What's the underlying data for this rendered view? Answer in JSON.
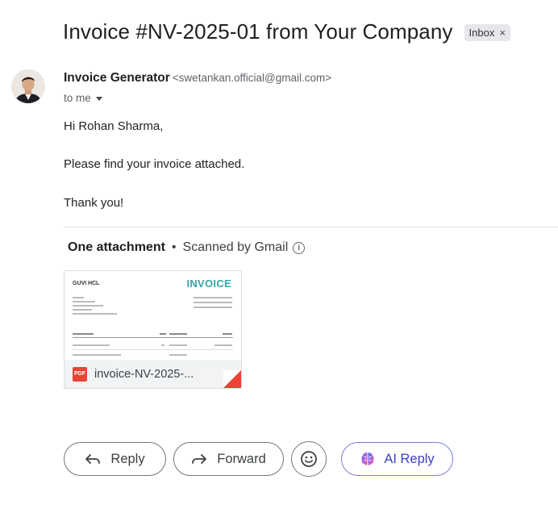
{
  "email": {
    "subject": "Invoice #NV-2025-01 from Your Company",
    "label": "Inbox",
    "label_remove": "×",
    "sender_name": "Invoice Generator",
    "sender_email": "<swetankan.official@gmail.com>",
    "recipient": "to me",
    "body": {
      "greeting": "Hi Rohan Sharma,",
      "message": "Please find your invoice attached.",
      "closing": "Thank you!"
    }
  },
  "attachments": {
    "count_label": "One attachment",
    "separator": "•",
    "scan_label": "Scanned by Gmail",
    "items": [
      {
        "file_name": "invoice-NV-2025-...",
        "file_type": "PDF",
        "thumbnail_company": "GUVI HCL",
        "thumbnail_title": "INVOICE",
        "accent_color": "#35a6a6"
      }
    ]
  },
  "actions": {
    "reply": "Reply",
    "forward": "Forward",
    "emoji": "emoji-icon",
    "ai_reply": "AI Reply"
  },
  "colors": {
    "pdf_red": "#ea4335",
    "ai_accent": "#3b3fc6"
  }
}
